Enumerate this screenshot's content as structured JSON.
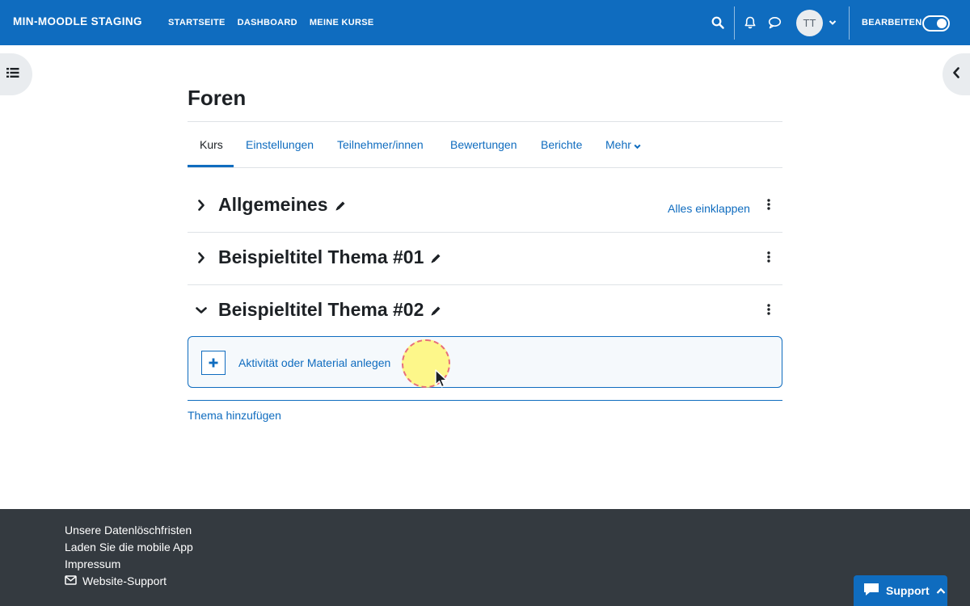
{
  "navbar": {
    "brand": "MIN-MOODLE STAGING",
    "links": [
      "STARTSEITE",
      "DASHBOARD",
      "MEINE KURSE"
    ],
    "avatar_initials": "TT",
    "edit_mode_label": "BEARBEITEN",
    "edit_mode_on": true,
    "color": "#0f6cbf"
  },
  "page": {
    "title": "Foren"
  },
  "secondary_nav": {
    "tabs": [
      "Kurs",
      "Einstellungen",
      "Teilnehmer/innen",
      "Bewertungen",
      "Berichte",
      "Mehr"
    ],
    "active_tab": "Kurs"
  },
  "sections": [
    {
      "title": "Allgemeines",
      "expanded": false
    },
    {
      "title": "Beispieltitel Thema #01",
      "expanded": false
    },
    {
      "title": "Beispieltitel Thema #02",
      "expanded": true
    }
  ],
  "collapse_all_label": "Alles einklappen",
  "add_activity_label": "Aktivität oder Material anlegen",
  "add_topic_label": "Thema hinzufügen",
  "footer": {
    "links": [
      "Unsere Datenlöschfristen",
      "Laden Sie die mobile App",
      "Impressum",
      "Website-Support"
    ],
    "support_button": "Support"
  }
}
